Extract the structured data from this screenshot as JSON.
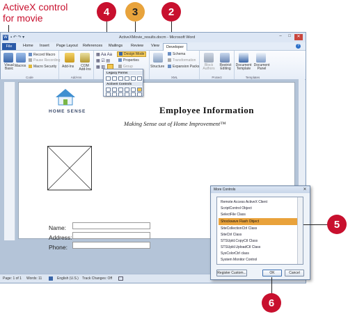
{
  "callout": {
    "line1": "ActiveX control",
    "line2": "for movie"
  },
  "badges": [
    "4",
    "3",
    "2",
    "5",
    "6"
  ],
  "colors": {
    "callout": "#c8102e",
    "highlight": "#e9a23b",
    "ribbon_tab_file": "#2a5aa8"
  },
  "window": {
    "title": "ActiveXMovie_results.docm - Microsoft Word",
    "controls": [
      "minimize-icon",
      "maximize-icon",
      "close-icon"
    ]
  },
  "tabs": [
    "File",
    "Home",
    "Insert",
    "Page Layout",
    "References",
    "Mailings",
    "Review",
    "View",
    "Developer"
  ],
  "ribbon": {
    "code": {
      "label": "Code",
      "visual_basic": "Visual Basic",
      "macros": "Macros",
      "record_macro": "Record Macro",
      "pause_recording": "Pause Recording",
      "macro_security": "Macro Security"
    },
    "addins": {
      "label": "Add-Ins",
      "addins": "Add-Ins",
      "com_addins": "COM Add-Ins"
    },
    "controls": {
      "label": "Controls",
      "design_mode": "Design Mode",
      "properties": "Properties",
      "group": "Group"
    },
    "xml": {
      "label": "XML",
      "structure": "Structure",
      "schema": "Schema",
      "transformation": "Transformation",
      "expansion_packs": "Expansion Packs"
    },
    "protect": {
      "label": "Protect",
      "block_authors": "Block Authors",
      "restrict_editing": "Restrict Editing"
    },
    "templates": {
      "label": "Templates",
      "document_template": "Document Template",
      "document_panel": "Document Panel"
    }
  },
  "legacy_popup": {
    "legacy_forms": "Legacy Forms",
    "activex_controls": "ActiveX Controls"
  },
  "document": {
    "logo_text": "HOME SENSE",
    "heading": "Employee Information",
    "tagline": "Making Sense out of Home Improvement™",
    "form_labels": [
      "Name:",
      "Address:",
      "Phone:"
    ]
  },
  "statusbar": {
    "page": "Page: 1 of 1",
    "words": "Words: 11",
    "language": "English (U.S.)",
    "track_changes": "Track Changes: Off"
  },
  "dialog": {
    "title": "More Controls",
    "items": [
      "Remote Access ActiveX Client",
      "ScriptControl Object",
      "SelectFile Class",
      "Shockwave Flash Object",
      "SiteCollectionCtrl Class",
      "SiteCtrl Class",
      "STSUpld.CopyCtl Class",
      "STSUpld.UploadCtl Class",
      "SysColorCtrl class",
      "System Monitor Control"
    ],
    "selected_index": 3,
    "register_button": "Register Custom...",
    "ok_button": "OK",
    "cancel_button": "Cancel"
  }
}
